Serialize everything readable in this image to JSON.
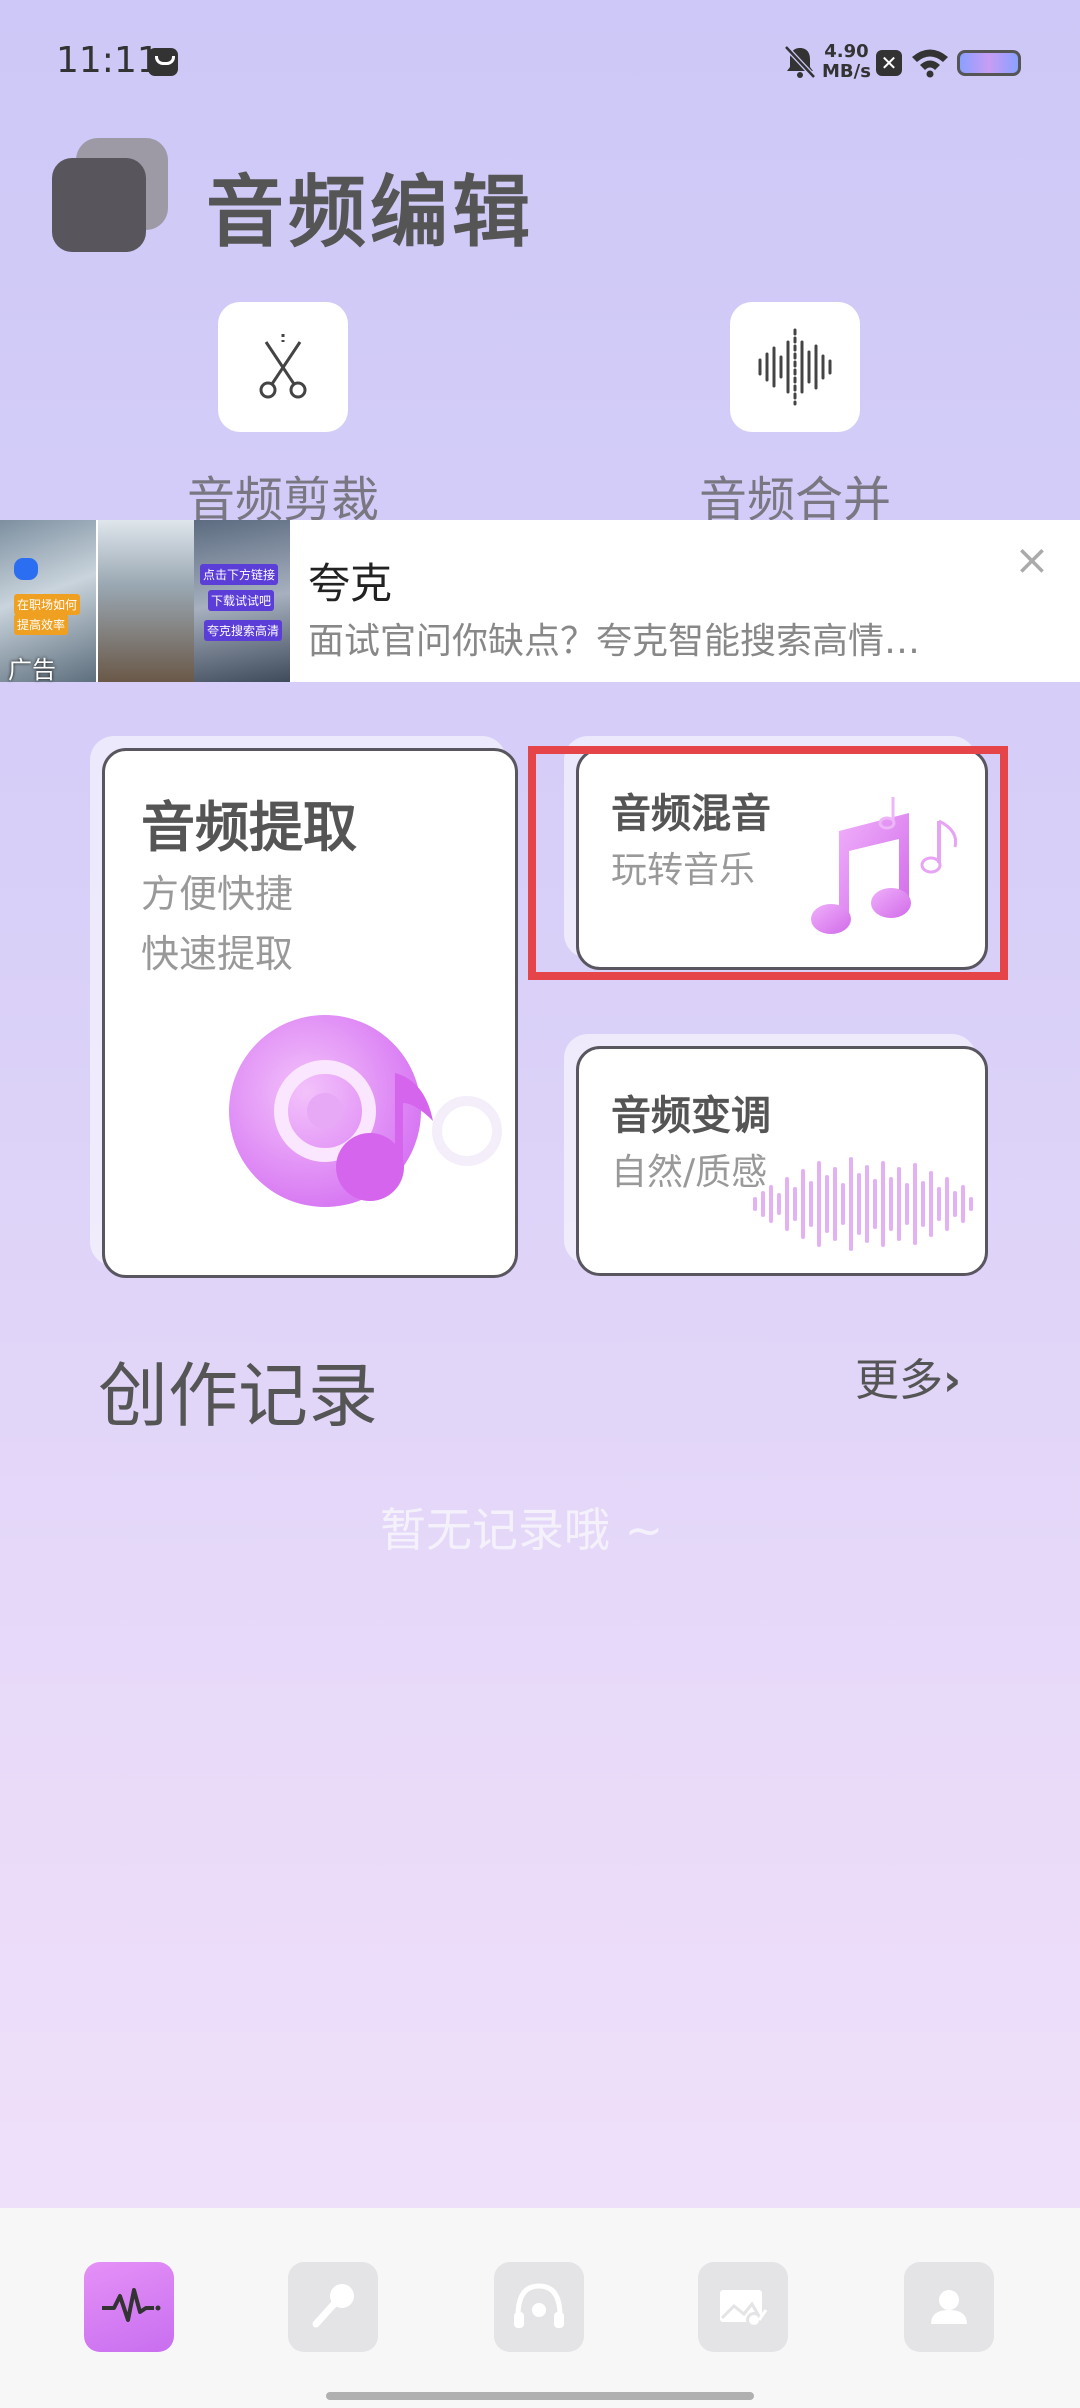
{
  "status_bar": {
    "time": "11:11",
    "speed_value": "4.90",
    "speed_unit": "MB/s"
  },
  "header": {
    "title": "音频编辑"
  },
  "tools": {
    "cut_label": "音频剪裁",
    "merge_label": "音频合并"
  },
  "ad": {
    "title": "夸克",
    "description": "面试官问你缺点？夸克智能搜索高情…",
    "tag": "广告",
    "close_icon": "close-icon",
    "thumb_texts": [
      "在职场如何",
      "提高效率",
      "点击下方链接",
      "下载试试吧",
      "夸克搜索高清"
    ]
  },
  "cards": {
    "extract": {
      "title": "音频提取",
      "sub1": "方便快捷",
      "sub2": "快速提取"
    },
    "mix": {
      "title": "音频混音",
      "sub": "玩转音乐"
    },
    "tune": {
      "title": "音频变调",
      "sub": "自然/质感"
    }
  },
  "records": {
    "title": "创作记录",
    "more": "更多",
    "empty": "暂无记录哦 ~"
  },
  "bottom_nav": {
    "items": [
      "waveform-icon",
      "microphone-icon",
      "headset-icon",
      "media-icon",
      "profile-icon"
    ]
  },
  "colors": {
    "accent": "#d67ef5",
    "highlight": "#e54548"
  }
}
